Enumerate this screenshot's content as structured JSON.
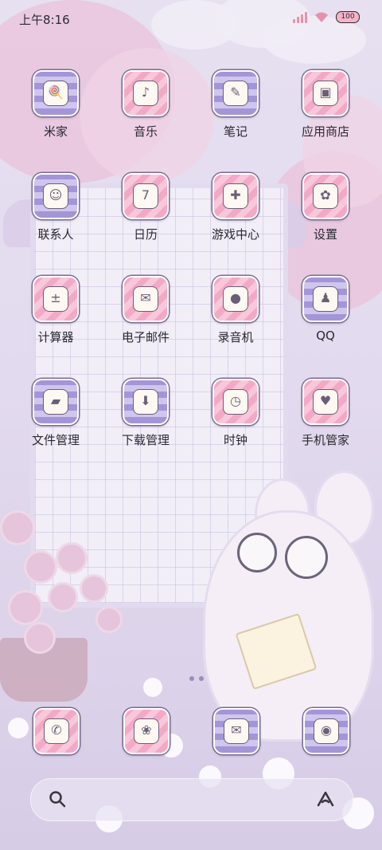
{
  "status_bar": {
    "time": "上午8:16",
    "battery": "100"
  },
  "apps": [
    {
      "label": "米家",
      "glyph": "🍭",
      "style": "purple"
    },
    {
      "label": "音乐",
      "glyph": "♪",
      "style": "pink"
    },
    {
      "label": "笔记",
      "glyph": "✎",
      "style": "purple"
    },
    {
      "label": "应用商店",
      "glyph": "▣",
      "style": "pink"
    },
    {
      "label": "联系人",
      "glyph": "☺",
      "style": "purple"
    },
    {
      "label": "日历",
      "glyph": "7",
      "style": "pink"
    },
    {
      "label": "游戏中心",
      "glyph": "✚",
      "style": "pink"
    },
    {
      "label": "设置",
      "glyph": "✿",
      "style": "pink"
    },
    {
      "label": "计算器",
      "glyph": "±",
      "style": "pink"
    },
    {
      "label": "电子邮件",
      "glyph": "✉",
      "style": "pink"
    },
    {
      "label": "录音机",
      "glyph": "●",
      "style": "pink"
    },
    {
      "label": "QQ",
      "glyph": "♟",
      "style": "purple"
    },
    {
      "label": "文件管理",
      "glyph": "▰",
      "style": "purple"
    },
    {
      "label": "下载管理",
      "glyph": "⬇",
      "style": "purple"
    },
    {
      "label": "时钟",
      "glyph": "◷",
      "style": "pink"
    },
    {
      "label": "手机管家",
      "glyph": "♥",
      "style": "pink"
    }
  ],
  "dock": [
    {
      "glyph": "✆",
      "style": "pink"
    },
    {
      "glyph": "❀",
      "style": "pink"
    },
    {
      "glyph": "✉",
      "style": "purple"
    },
    {
      "glyph": "◉",
      "style": "purple"
    }
  ],
  "colors": {
    "pink": "#f3a9c6",
    "purple": "#a495d8",
    "text": "#2b2830"
  }
}
